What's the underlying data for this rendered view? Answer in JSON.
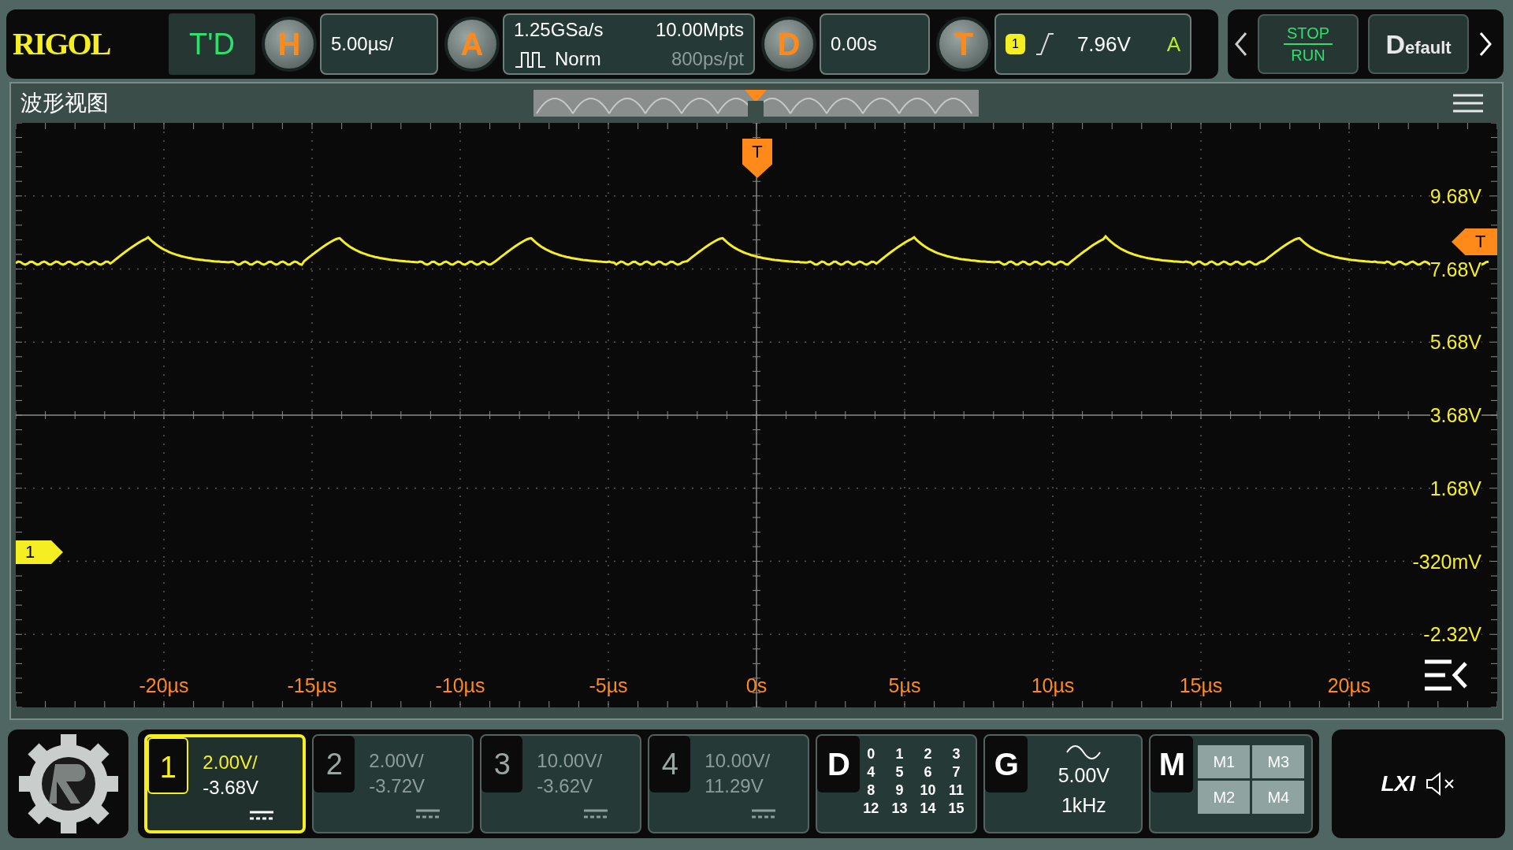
{
  "top_bar": {
    "logo": "RIGOL",
    "mode": "T'D",
    "horizontal": {
      "label": "H",
      "scale": "5.00µs/"
    },
    "acquire": {
      "label": "A",
      "sample_rate": "1.25GSa/s",
      "acq_mode": "Norm",
      "depth": "10.00Mpts",
      "resolution": "800ps/pt"
    },
    "delay": {
      "label": "D",
      "value": "0.00s"
    },
    "trigger": {
      "label": "T",
      "source": "1",
      "level": "7.96V",
      "sweep": "A"
    },
    "run_stop": {
      "top": "STOP",
      "bottom": "RUN"
    },
    "default_button": "Default"
  },
  "waveform_view": {
    "title": "波形视图",
    "voltage_labels": [
      "9.68V",
      "7.68V",
      "5.68V",
      "3.68V",
      "1.68V",
      "-320mV",
      "-2.32V"
    ],
    "time_labels": [
      "-20µs",
      "-15µs",
      "-10µs",
      "-5µs",
      "0s",
      "5µs",
      "10µs",
      "15µs",
      "20µs"
    ],
    "channel_marker": "1",
    "trigger_marker": "T",
    "trigger_level_marker": "T"
  },
  "channels": [
    {
      "number": "1",
      "scale": "2.00V/",
      "offset": "-3.68V",
      "on": true
    },
    {
      "number": "2",
      "scale": "2.00V/",
      "offset": "-3.72V",
      "on": false
    },
    {
      "number": "3",
      "scale": "10.00V/",
      "offset": "-3.62V",
      "on": false
    },
    {
      "number": "4",
      "scale": "10.00V/",
      "offset": "11.29V",
      "on": false
    }
  ],
  "digital": {
    "label": "D",
    "bits": [
      "0",
      "1",
      "2",
      "3",
      "4",
      "5",
      "6",
      "7",
      "8",
      "9",
      "10",
      "11",
      "12",
      "13",
      "14",
      "15"
    ]
  },
  "generator": {
    "label": "G",
    "amplitude": "5.00V",
    "frequency": "1kHz"
  },
  "math": {
    "label": "M",
    "items": [
      "M1",
      "M3",
      "M2",
      "M4"
    ]
  },
  "status": {
    "lxi": "LXI"
  }
}
